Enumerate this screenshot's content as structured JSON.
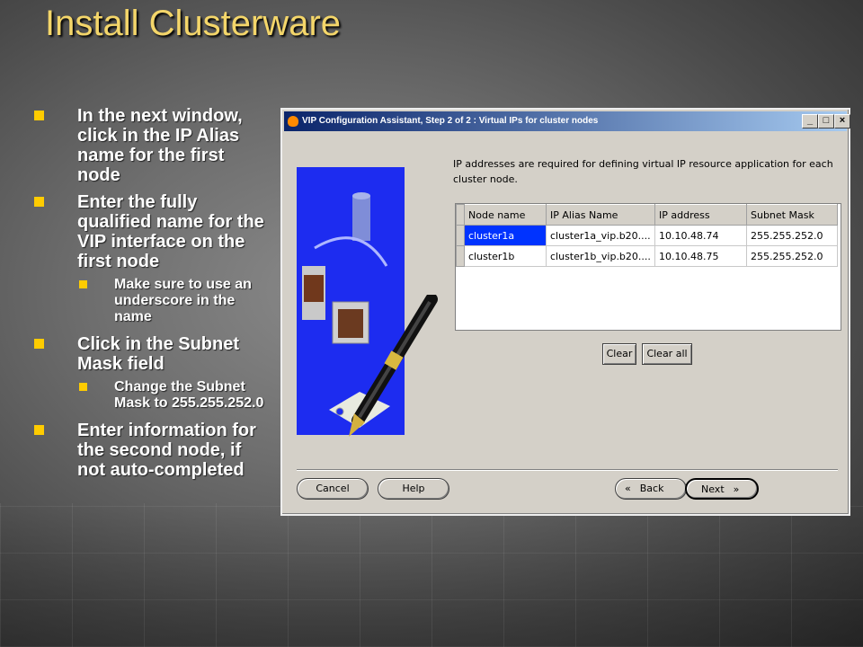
{
  "slide": {
    "title": "Install Clusterware",
    "bullets": [
      {
        "level": 1,
        "text": "In the next window, click in the IP Alias name for the first node"
      },
      {
        "level": 1,
        "text": "Enter the fully qualified name for the VIP interface on the first node"
      },
      {
        "level": 2,
        "text": "Make sure to use an underscore in the name"
      },
      {
        "level": 1,
        "text": "Click in the Subnet Mask field"
      },
      {
        "level": 2,
        "text": "Change the Subnet Mask to 255.255.252.0"
      },
      {
        "level": 1,
        "text": "Enter information for the second node, if not auto-completed"
      }
    ]
  },
  "window": {
    "title": "VIP Configuration Assistant, Step 2 of 2 : Virtual IPs for cluster nodes",
    "controls": {
      "minimize": "_",
      "maximize": "□",
      "close": "×"
    },
    "description": "IP addresses are required for defining virtual IP resource application for each cluster node.",
    "table": {
      "columns": [
        "Node name",
        "IP Alias Name",
        "IP address",
        "Subnet Mask"
      ],
      "rows": [
        [
          "cluster1a",
          "cluster1a_vip.b20....",
          "10.10.48.74",
          "255.255.252.0"
        ],
        [
          "cluster1b",
          "cluster1b_vip.b20....",
          "10.10.48.75",
          "255.255.252.0"
        ]
      ],
      "selected_cell": {
        "row": 0,
        "col": 0
      }
    },
    "buttons": {
      "clear": "Clear",
      "clear_all": "Clear all",
      "cancel": "Cancel",
      "help": "Help",
      "back": "Back",
      "next": "Next"
    }
  },
  "colors": {
    "title": "#f4d66a",
    "bullet_mark": "#ffcc00",
    "selection": "#0033ff",
    "titlebar": "#0a246a"
  },
  "icons": [
    "window-app-icon",
    "back-arrow-icon",
    "next-arrow-icon",
    "pen-illustration"
  ]
}
